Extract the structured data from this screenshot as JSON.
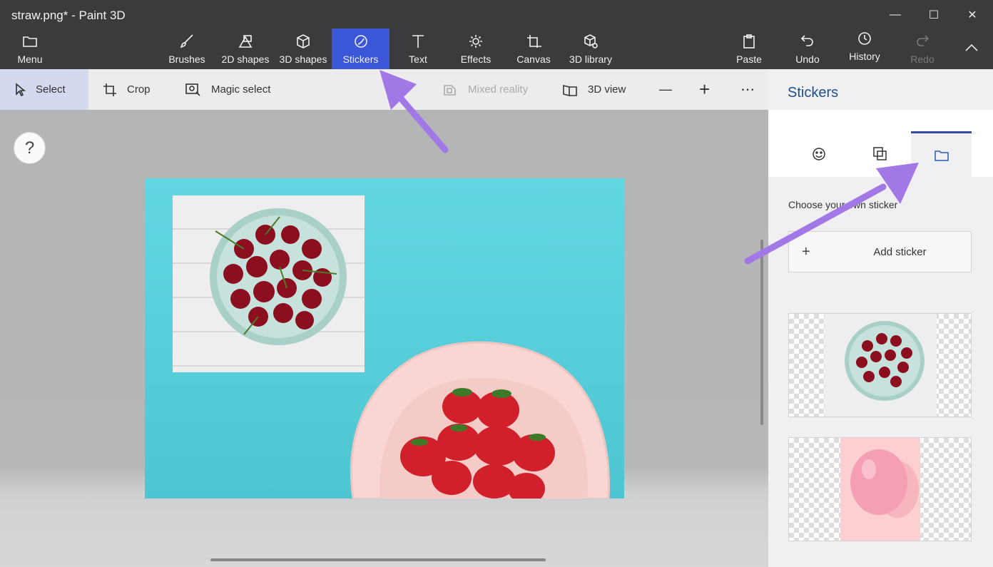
{
  "window": {
    "title": "straw.png* - Paint 3D",
    "minimize_glyph": "—",
    "maximize_glyph": "☐",
    "close_glyph": "✕"
  },
  "toolbar": {
    "menu_label": "Menu",
    "tools": [
      {
        "label": "Brushes",
        "icon": "brush-icon"
      },
      {
        "label": "2D shapes",
        "icon": "2d-shapes-icon"
      },
      {
        "label": "3D shapes",
        "icon": "3d-shapes-icon"
      },
      {
        "label": "Stickers",
        "icon": "stickers-icon",
        "active": true
      },
      {
        "label": "Text",
        "icon": "text-icon"
      },
      {
        "label": "Effects",
        "icon": "effects-icon"
      },
      {
        "label": "Canvas",
        "icon": "canvas-icon"
      },
      {
        "label": "3D library",
        "icon": "3d-library-icon"
      }
    ],
    "right": [
      {
        "label": "Paste",
        "icon": "paste-icon"
      },
      {
        "label": "Undo",
        "icon": "undo-icon"
      },
      {
        "label": "History",
        "icon": "history-icon"
      },
      {
        "label": "Redo",
        "icon": "redo-icon",
        "disabled": true
      }
    ]
  },
  "subtoolbar": {
    "select_label": "Select",
    "crop_label": "Crop",
    "magic_select_label": "Magic select",
    "mixed_reality_label": "Mixed reality",
    "view_3d_label": "3D view",
    "zoom_out_glyph": "—",
    "zoom_in_glyph": "+",
    "more_glyph": "⋯"
  },
  "canvas": {
    "help_glyph": "?",
    "background_color": "#4ec5d2"
  },
  "panel": {
    "title": "Stickers",
    "tabs": [
      {
        "icon": "sticker-face-icon"
      },
      {
        "icon": "textures-icon"
      },
      {
        "icon": "custom-sticker-folder-icon",
        "active": true
      }
    ],
    "choose_label": "Choose your own sticker",
    "add_sticker_label": "Add sticker",
    "plus_glyph": "+"
  },
  "colors": {
    "accent": "#3b57d8",
    "arrow": "#a277e6",
    "panel_title": "#1f4e8c"
  }
}
